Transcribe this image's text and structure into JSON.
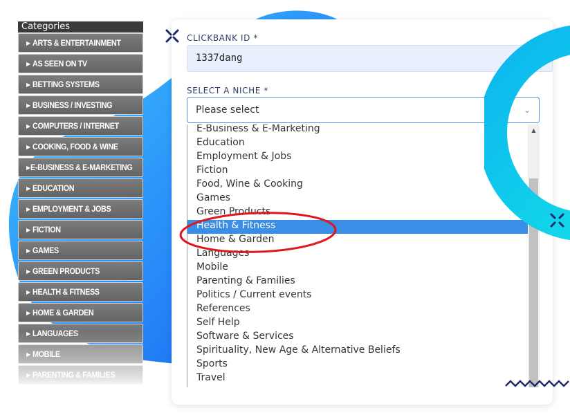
{
  "sidebar": {
    "header": "Categories",
    "items": [
      "ARTS & ENTERTAINMENT",
      "AS SEEN ON TV",
      "BETTING SYSTEMS",
      "BUSINESS / INVESTING",
      "COMPUTERS / INTERNET",
      "COOKING, FOOD & WINE",
      "E-BUSINESS & E-MARKETING",
      "EDUCATION",
      "EMPLOYMENT & JOBS",
      "FICTION",
      "GAMES",
      "GREEN PRODUCTS",
      "HEALTH & FITNESS",
      "HOME & GARDEN",
      "LANGUAGES",
      "MOBILE",
      "PARENTING & FAMILIES"
    ]
  },
  "form": {
    "clickbank_label": "CLICKBANK ID *",
    "clickbank_value": "1337dang",
    "niche_label": "SELECT A NICHE *",
    "niche_placeholder": "Please select",
    "options": [
      "E-Business & E-Marketing",
      "Education",
      "Employment & Jobs",
      "Fiction",
      "Food, Wine & Cooking",
      "Games",
      "Green Products",
      "Health & Fitness",
      "Home & Garden",
      "Languages",
      "Mobile",
      "Parenting & Families",
      "Politics / Current events",
      "References",
      "Self Help",
      "Software & Services",
      "Spirituality, New Age & Alternative Beliefs",
      "Sports",
      "Travel"
    ],
    "selected_option": "Health & Fitness"
  },
  "colors": {
    "accent": "#3a8ee6",
    "annotation": "#e0161e",
    "blob": "#1a73f5",
    "ring": "#14c8e8"
  }
}
